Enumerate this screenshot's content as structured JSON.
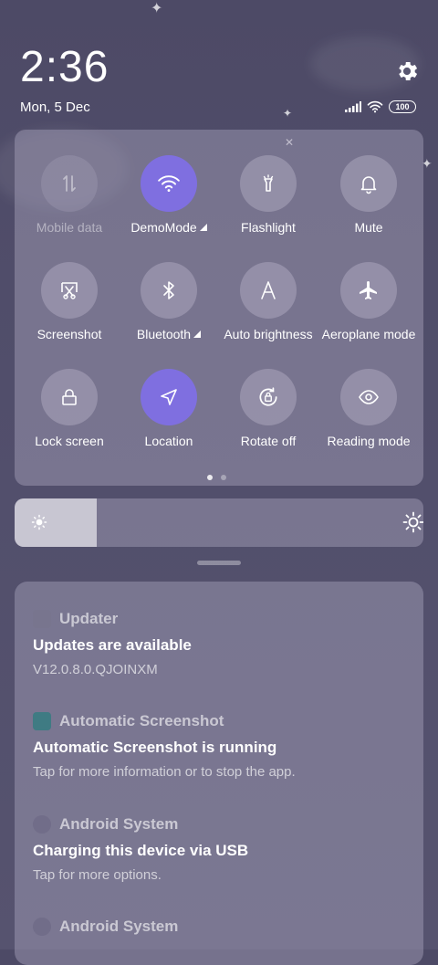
{
  "status": {
    "time": "2:36",
    "date": "Mon, 5 Dec",
    "battery": "100"
  },
  "quick_settings": {
    "tiles": [
      {
        "label": "Mobile data",
        "icon": "mobile-data-icon",
        "state": "disabled"
      },
      {
        "label": "DemoMode",
        "icon": "wifi-icon",
        "state": "active"
      },
      {
        "label": "Flashlight",
        "icon": "flashlight-icon",
        "state": "off"
      },
      {
        "label": "Mute",
        "icon": "bell-icon",
        "state": "off"
      },
      {
        "label": "Screenshot",
        "icon": "screenshot-icon",
        "state": "off"
      },
      {
        "label": "Bluetooth",
        "icon": "bluetooth-icon",
        "state": "off"
      },
      {
        "label": "Auto brightness",
        "icon": "auto-brightness-icon",
        "state": "off"
      },
      {
        "label": "Aeroplane mode",
        "icon": "airplane-icon",
        "state": "off"
      },
      {
        "label": "Lock screen",
        "icon": "lock-icon",
        "state": "off"
      },
      {
        "label": "Location",
        "icon": "location-icon",
        "state": "active"
      },
      {
        "label": "Rotate off",
        "icon": "rotate-lock-icon",
        "state": "off"
      },
      {
        "label": "Reading mode",
        "icon": "eye-icon",
        "state": "off"
      }
    ],
    "active_color": "#7f6fe0",
    "page_count": 2,
    "current_page": 1
  },
  "brightness": {
    "level_fraction": 0.2
  },
  "notifications": [
    {
      "app": "Updater",
      "title": "Updates are available",
      "body": "V12.0.8.0.QJOINXM"
    },
    {
      "app": "Automatic Screenshot",
      "title": "Automatic Screenshot is running",
      "body": "Tap for more information or to stop the app."
    },
    {
      "app": "Android System",
      "title": "Charging this device via USB",
      "body": "Tap for more options."
    },
    {
      "app": "Android System",
      "title": "",
      "body": ""
    }
  ]
}
